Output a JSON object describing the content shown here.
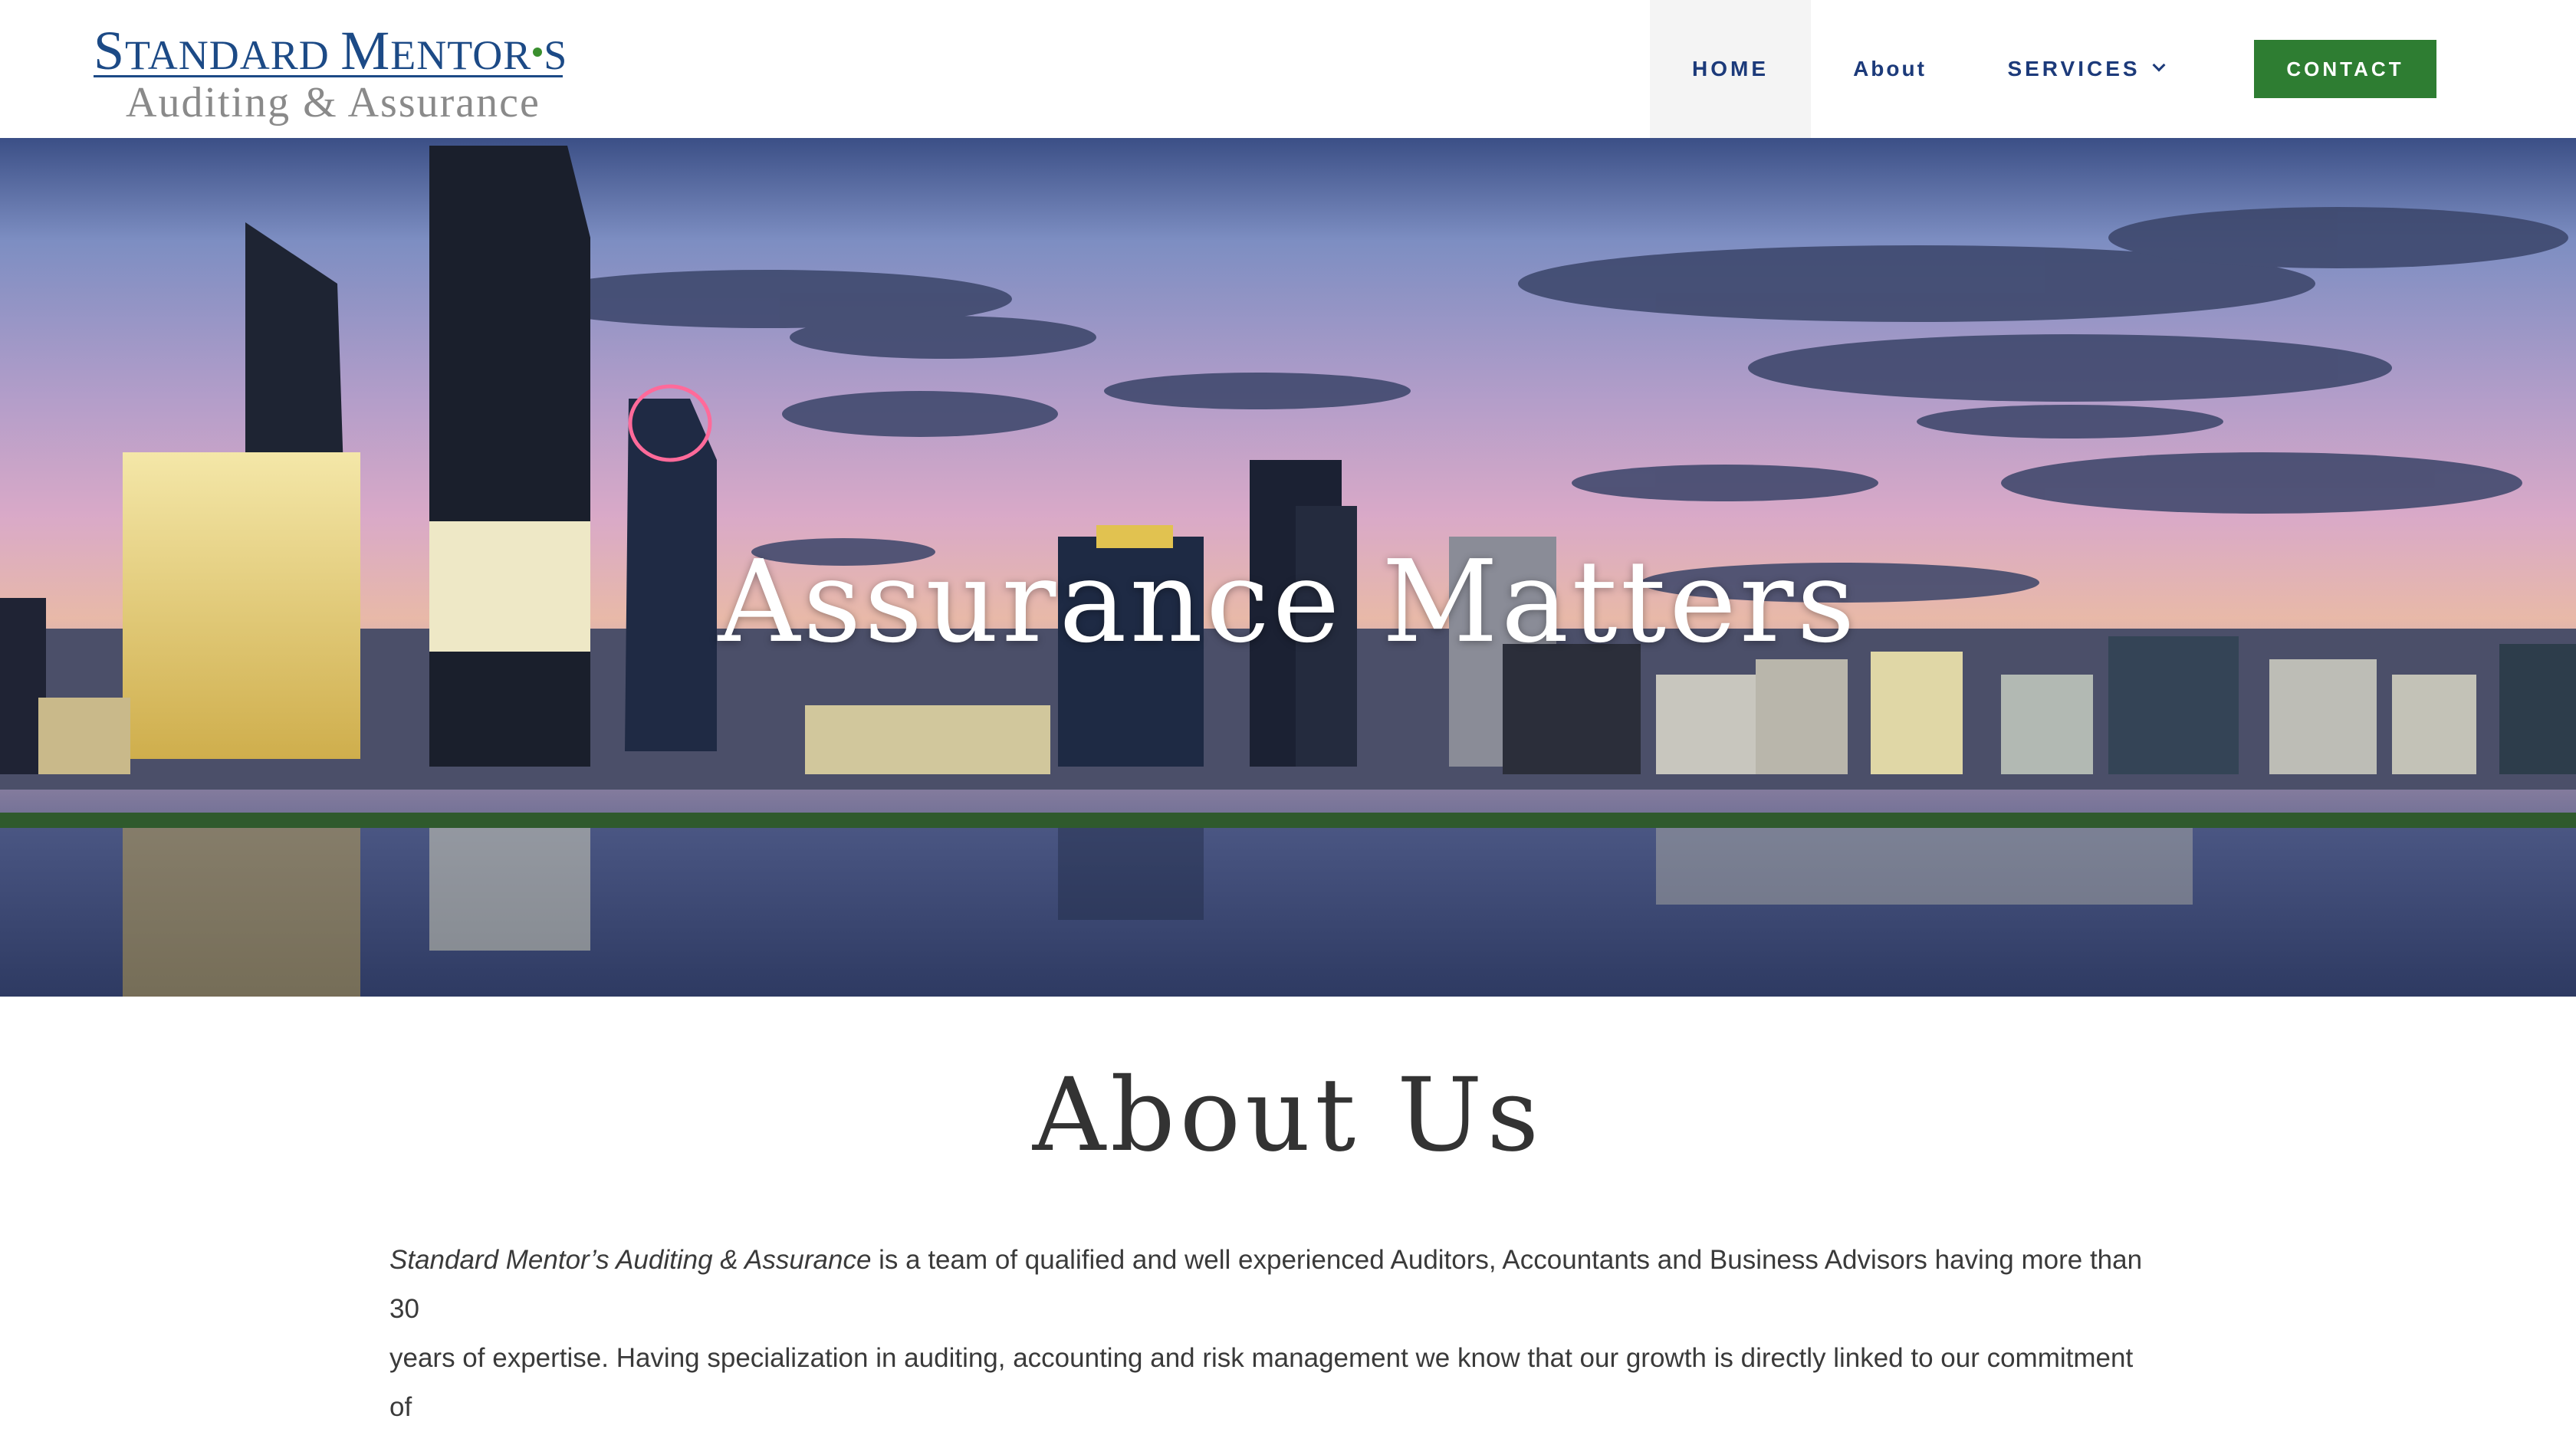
{
  "header": {
    "logo": {
      "line1_parts": [
        "S",
        "TANDARD ",
        "M",
        "ENTOR",
        "S"
      ],
      "line2": "Auditing & Assurance"
    },
    "nav": {
      "home": "HOME",
      "about": "About",
      "services": "SERVICES",
      "contact": "CONTACT"
    }
  },
  "hero": {
    "title": "Assurance Matters"
  },
  "about": {
    "title": "About Us",
    "company_name": "Standard Mentor’s Auditing & Assurance",
    "line1_rest": " is a team of qualified and well experienced Auditors, Accountants and Business Advisors having more than 30",
    "line2": "years of expertise. Having specialization in auditing, accounting and risk management we know that our growth is directly linked to our commitment of"
  },
  "colors": {
    "brand_blue": "#1c4a86",
    "nav_text": "#1c3a7a",
    "contact_green": "#2e7d32",
    "home_bg": "#f4f4f4"
  },
  "icons": {
    "services_dropdown": "chevron-down-icon"
  }
}
